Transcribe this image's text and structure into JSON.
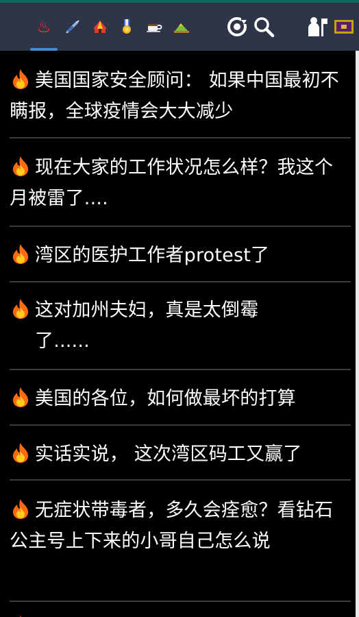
{
  "app": {
    "name": "forum-mobile-reader"
  },
  "toolbar": {
    "tabs": [
      {
        "icon": "hot-springs-icon",
        "glyph": "♨"
      },
      {
        "icon": "syringe-icon",
        "glyph": ""
      },
      {
        "icon": "circus-tent-icon",
        "glyph": ""
      },
      {
        "icon": "medal-icon",
        "glyph": ""
      },
      {
        "icon": "coffee-icon",
        "glyph": ""
      },
      {
        "icon": "hill-icon",
        "glyph": ""
      }
    ],
    "active_tab": 0,
    "tools": [
      {
        "icon": "refresh-icon"
      },
      {
        "icon": "search-icon"
      },
      {
        "icon": "user-settings-icon"
      },
      {
        "icon": "flag-icon"
      }
    ]
  },
  "posts": [
    {
      "title": "美国国家安全顾问： 如果中国最初不瞒报，全球疫情会大大减少"
    },
    {
      "title": "现在大家的工作状况怎么样？我这个月被雷了...."
    },
    {
      "title": "湾区的医护工作者protest了"
    },
    {
      "title": "这对加州夫妇，真是太倒霉了......"
    },
    {
      "title": "美国的各位，如何做最坏的打算"
    },
    {
      "title": "实话实说， 这次湾区码工又赢了"
    },
    {
      "title": "无症状带毒者，多久会痊愈？看钻石公主号上下来的小哥自己怎么说"
    }
  ],
  "colors": {
    "toolbar_bg": "#2e3549",
    "accent_top": "#0b6b5e",
    "tab_indicator": "#3d8bd9",
    "list_bg": "#000000",
    "text": "#ffffff",
    "divider": "#3c3c3c",
    "hot_icon": "#ff6a13"
  }
}
